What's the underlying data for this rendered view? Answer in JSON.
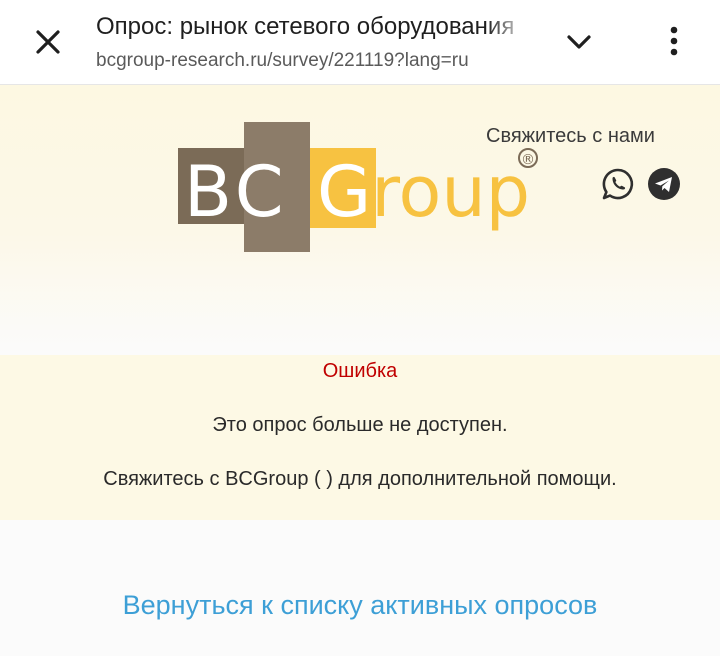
{
  "browser": {
    "page_title": "Опрос: рынок сетевого оборудования",
    "url": "bcgroup-research.ru/survey/221119?lang=ru",
    "close_icon": "close-icon",
    "chevron_icon": "chevron-down-icon",
    "menu_icon": "more-vert-icon"
  },
  "header": {
    "logo": {
      "text_bc": "BC",
      "text_group": "Group",
      "registered": "®"
    },
    "contact_label": "Свяжитесь с нами",
    "contact_icons": [
      "whatsapp-icon",
      "telegram-icon"
    ]
  },
  "message": {
    "title": "Ошибка",
    "text": "Это опрос больше не доступен.",
    "help": "Свяжитесь с BCGroup ( ) для дополнительной помощи."
  },
  "back_link": "Вернуться к списку активных опросов",
  "colors": {
    "error": "#c00000",
    "link": "#3d9fd6",
    "logo_brown": "#7b6b57",
    "logo_gold": "#f7c241"
  }
}
